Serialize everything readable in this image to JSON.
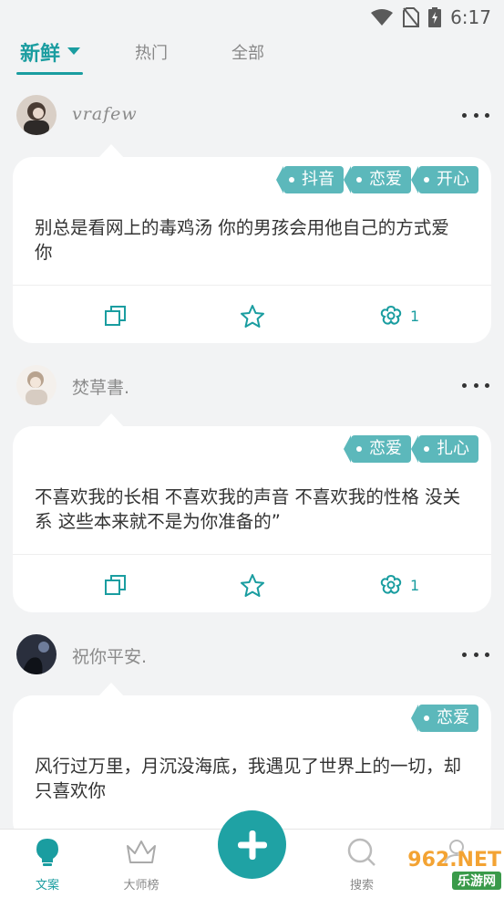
{
  "status": {
    "time": "6:17"
  },
  "tabs": [
    {
      "label": "新鲜"
    },
    {
      "label": "热门"
    },
    {
      "label": "全部"
    }
  ],
  "posts": [
    {
      "username": "vrafew",
      "tags": [
        "抖音",
        "恋爱",
        "开心"
      ],
      "text": "别总是看网上的毒鸡汤 你的男孩会用他自己的方式爱你",
      "like_count": "1"
    },
    {
      "username": "焚草書.",
      "tags": [
        "恋爱",
        "扎心"
      ],
      "text": "不喜欢我的长相 不喜欢我的声音 不喜欢我的性格 没关系 这些本来就不是为你准备的”",
      "like_count": "1"
    },
    {
      "username": "祝你平安.",
      "tags": [
        "恋爱"
      ],
      "text": "风行过万里，月沉没海底，我遇见了世界上的一切，却只喜欢你"
    }
  ],
  "nav": {
    "wenan": "文案",
    "dashibang": "大师榜",
    "search": "搜索"
  },
  "watermark": {
    "top": "962.NET",
    "bottom": "乐游网"
  },
  "colors": {
    "accent": "#1a9da0",
    "tag": "#5cb8bb",
    "background": "#f2f3f4"
  }
}
